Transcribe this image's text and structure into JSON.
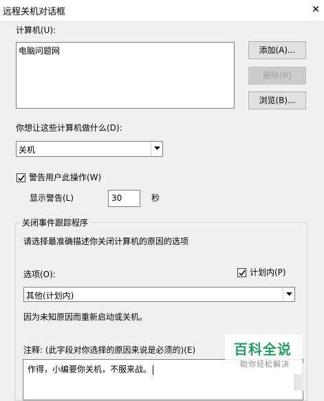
{
  "window": {
    "title": "远程关机对话框"
  },
  "computers": {
    "label": "计算机(U):",
    "items": [
      "电脑问题网"
    ]
  },
  "buttons": {
    "add": "添加(A)...",
    "remove": "删除(R)",
    "browse": "浏览(B)..."
  },
  "action": {
    "label": "你想让这些计算机做什么(D):",
    "selected": "关机"
  },
  "warn": {
    "checkbox_label": "警告用户此操作(W)",
    "checked": true,
    "display_label": "显示警告(L)",
    "seconds": "30",
    "unit": "秒"
  },
  "tracker": {
    "group_title": "关闭事件跟踪程序",
    "instruction": "请选择最准确描述你关闭计算机的原因的选项",
    "option_label": "选项(O):",
    "planned_label": "计划内(P)",
    "planned_checked": true,
    "option_selected": "其他(计划内)",
    "description": "因为未知原因而重新启动或关机。",
    "comment_label": "注释: (此字段对你选择的原因来说是必须的)(E)",
    "comment_value": "作得，小编要你关机，不服来战。"
  },
  "watermark": {
    "main": "百科全说",
    "sub": "助你轻松解决"
  }
}
